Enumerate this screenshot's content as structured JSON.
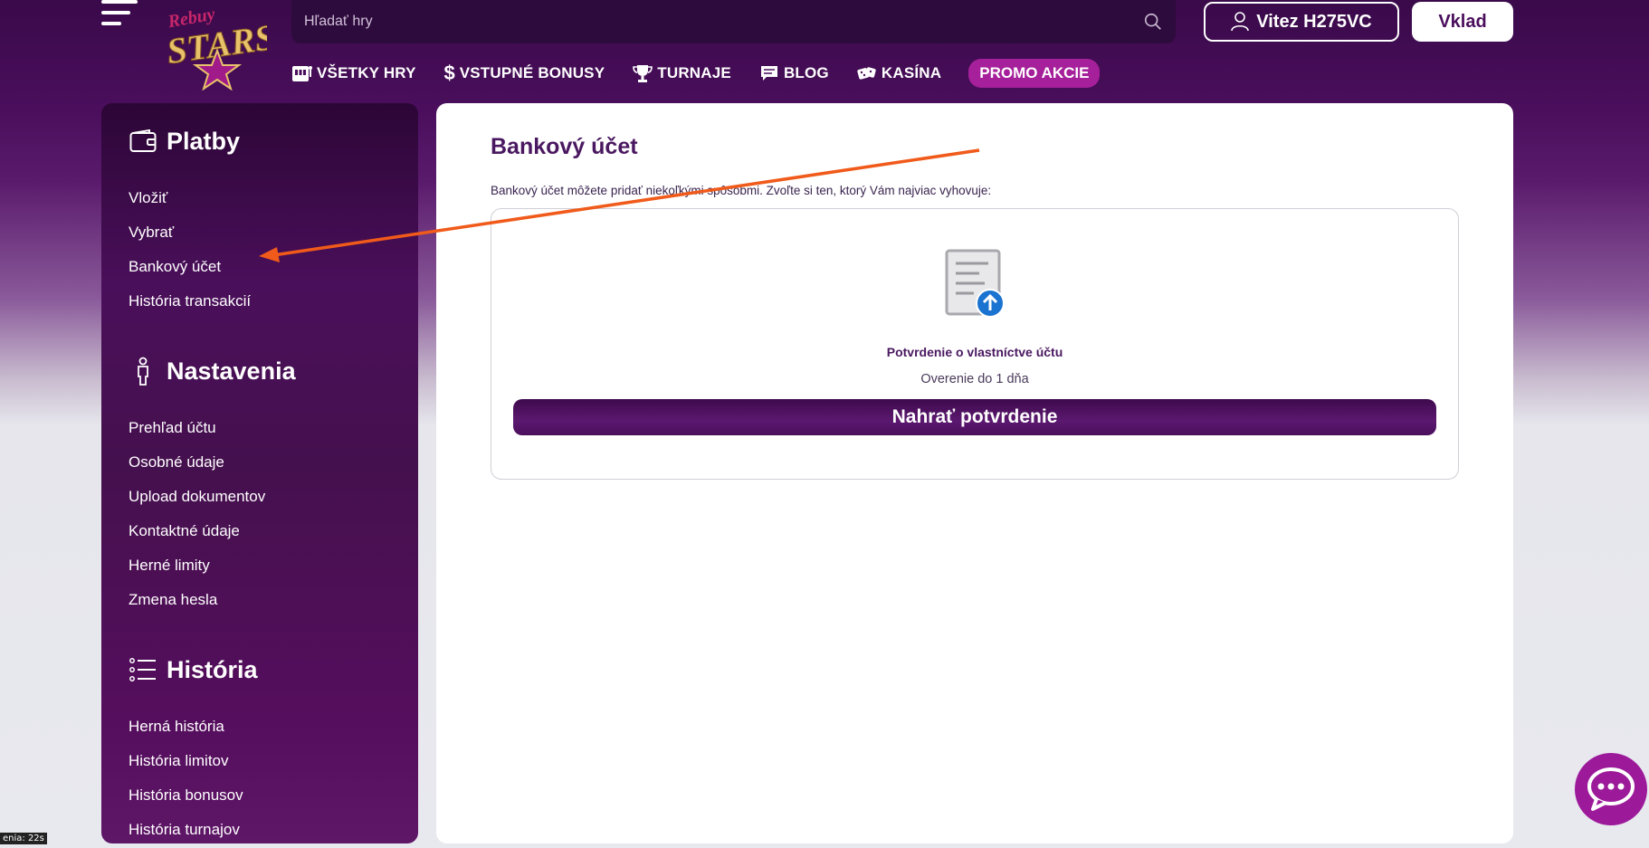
{
  "header": {
    "logo": "RebuyStars",
    "search_placeholder": "Hľadať hry",
    "username": "Vitez H275VC",
    "deposit_label": "Vklad",
    "nav": [
      {
        "label": "VŠETKY HRY",
        "icon": "slot-machine-icon"
      },
      {
        "label": "VSTUPNÉ BONUSY",
        "icon": "dollar-icon"
      },
      {
        "label": "TURNAJE",
        "icon": "trophy-icon"
      },
      {
        "label": "BLOG",
        "icon": "chat-bubble-icon"
      },
      {
        "label": "KASÍNA",
        "icon": "dice-icon"
      }
    ],
    "promo_label": "PROMO AKCIE"
  },
  "sidebar": {
    "sections": [
      {
        "title": "Platby",
        "icon": "wallet-icon",
        "items": [
          "Vložiť",
          "Vybrať",
          "Bankový účet",
          "História transakcií"
        ]
      },
      {
        "title": "Nastavenia",
        "icon": "person-icon",
        "items": [
          "Prehľad účtu",
          "Osobné údaje",
          "Upload dokumentov",
          "Kontaktné údaje",
          "Herné limity",
          "Zmena hesla"
        ]
      },
      {
        "title": "História",
        "icon": "list-icon",
        "items": [
          "Herná história",
          "História limitov",
          "História bonusov",
          "História turnajov"
        ]
      }
    ]
  },
  "main": {
    "title": "Bankový účet",
    "intro": "Bankový účet môžete pridať niekoľkými spôsobmi. Zvoľte si ten, ktorý Vám najviac vyhovuje:",
    "card": {
      "title": "Potvrdenie o vlastníctve účtu",
      "subtitle": "Overenie do 1 dňa",
      "button": "Nahrať potvrdenie"
    }
  },
  "timer": "enia: 22s",
  "colors": {
    "brand_purple": "#4a0e5c",
    "promo": "#a5209a",
    "annotation_arrow": "#f05a1a",
    "upload_badge": "#1a73d0"
  }
}
